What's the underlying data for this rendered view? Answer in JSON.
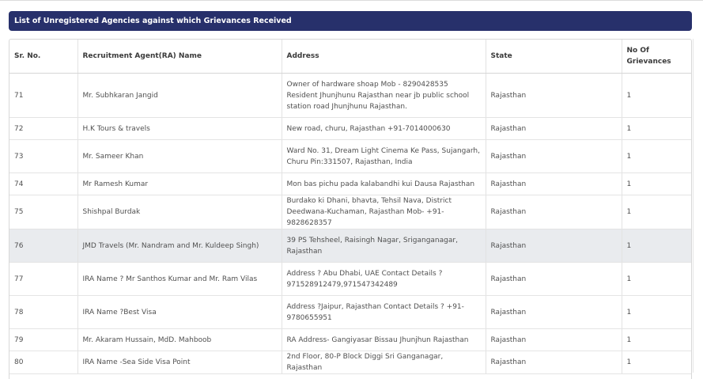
{
  "banner": {
    "title": "List of Unregistered Agencies against which Grievances Received"
  },
  "table": {
    "headers": {
      "sr": "Sr. No.",
      "name": "Recruitment Agent(RA) Name",
      "address": "Address",
      "state": "State",
      "grievances": "No Of Grievances"
    },
    "rows": [
      {
        "sr": "71",
        "name": "Mr. Subhkaran Jangid",
        "address": "Owner of hardware shoap Mob - 8290428535 Resident Jhunjhunu Rajasthan near jb public school station road Jhunjhunu Rajasthan.",
        "state": "Rajasthan",
        "grievances": "1"
      },
      {
        "sr": "72",
        "name": "H.K Tours & travels",
        "address": "New road, churu, Rajasthan +91-7014000630",
        "state": "Rajasthan",
        "grievances": "1"
      },
      {
        "sr": "73",
        "name": "Mr. Sameer Khan",
        "address": "Ward No. 31, Dream Light Cinema Ke Pass, Sujangarh, Churu Pin:331507, Rajasthan, India",
        "state": "Rajasthan",
        "grievances": "1"
      },
      {
        "sr": "74",
        "name": "Mr Ramesh Kumar",
        "address": "Mon bas pichu pada kalabandhi kui Dausa Rajasthan",
        "state": "Rajasthan",
        "grievances": "1"
      },
      {
        "sr": "75",
        "name": "Shishpal Burdak",
        "address": "Burdako ki Dhani, bhavta, Tehsil Nava, District Deedwana-Kuchaman, Rajasthan Mob- +91-9828628357",
        "state": "Rajasthan",
        "grievances": "1"
      },
      {
        "sr": "76",
        "name": "JMD Travels (Mr. Nandram and Mr. Kuldeep Singh)",
        "address": "39 PS Tehsheel, Raisingh Nagar, Sriganganagar, Rajasthan",
        "state": "Rajasthan",
        "grievances": "1"
      },
      {
        "sr": "77",
        "name": "IRA Name ? Mr Santhos Kumar and Mr. Ram Vilas",
        "address": "Address ? Abu Dhabi, UAE Contact Details ? 971528912479,971547342489",
        "state": "Rajasthan",
        "grievances": "1"
      },
      {
        "sr": "78",
        "name": "IRA Name ?Best Visa",
        "address": "Address ?Jaipur, Rajasthan Contact Details ? +91-9780655951",
        "state": "Rajasthan",
        "grievances": "1"
      },
      {
        "sr": "79",
        "name": "Mr. Akaram Hussain, MdD. Mahboob",
        "address": "RA Address- Gangiyasar Bissau Jhunjhun Rajasthan",
        "state": "Rajasthan",
        "grievances": "1"
      },
      {
        "sr": "80",
        "name": "IRA Name -Sea Side Visa Point",
        "address": "2nd Floor, 80-P Block Diggi Sri Ganganagar, Rajasthan",
        "state": "Rajasthan",
        "grievances": "1"
      }
    ]
  }
}
